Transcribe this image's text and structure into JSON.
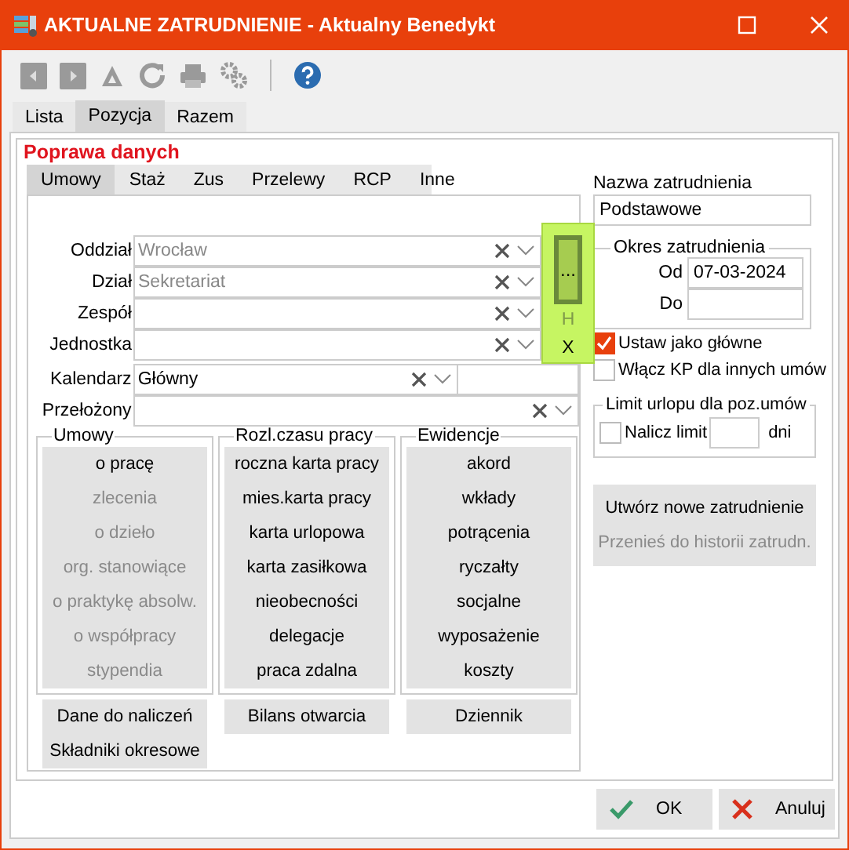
{
  "window": {
    "title": "AKTUALNE ZATRUDNIENIE - Aktualny Benedykt"
  },
  "tabs": [
    {
      "label": "Lista",
      "selected": false
    },
    {
      "label": "Pozycja",
      "selected": true
    },
    {
      "label": "Razem",
      "selected": false
    }
  ],
  "panel_title": "Poprawa danych",
  "subtabs": [
    {
      "label": "Umowy",
      "selected": true
    },
    {
      "label": "Staż",
      "selected": false
    },
    {
      "label": "Zus",
      "selected": false
    },
    {
      "label": "Przelewy",
      "selected": false
    },
    {
      "label": "RCP",
      "selected": false
    },
    {
      "label": "Inne",
      "selected": false
    }
  ],
  "fields": [
    {
      "label": "Oddział",
      "value": "Wrocław",
      "dimmed": true,
      "kind": "linked"
    },
    {
      "label": "Dział",
      "value": "Sekretariat",
      "dimmed": true,
      "kind": "linked"
    },
    {
      "label": "Zespół",
      "kind": "linked"
    },
    {
      "label": "Jednostka",
      "kind": "linked"
    },
    {
      "label": "Kalendarz",
      "value": "Główny",
      "dimmed": false,
      "kind": "short"
    },
    {
      "label": "Przełożony",
      "kind": "full"
    }
  ],
  "side_buttons": [
    {
      "label": "...",
      "kind": "button"
    },
    {
      "label": "H",
      "kind": "text",
      "disabled": true
    },
    {
      "label": "X",
      "kind": "text",
      "disabled": false
    }
  ],
  "groups": [
    {
      "title": "Umowy",
      "items": [
        {
          "label": "o pracę",
          "disabled": false
        },
        {
          "label": "zlecenia",
          "disabled": true
        },
        {
          "label": "o dzieło",
          "disabled": true
        },
        {
          "label": "org. stanowiące",
          "disabled": true
        },
        {
          "label": "o praktykę absolw.",
          "disabled": true
        },
        {
          "label": "o współpracy",
          "disabled": true
        },
        {
          "label": "stypendia",
          "disabled": true
        }
      ],
      "buttons": [
        "Dane do naliczeń",
        "Składniki okresowe"
      ]
    },
    {
      "title": "Rozl.czasu pracy",
      "items": [
        {
          "label": "roczna karta pracy",
          "disabled": false
        },
        {
          "label": "mies.karta pracy",
          "disabled": false
        },
        {
          "label": "karta urlopowa",
          "disabled": false
        },
        {
          "label": "karta zasiłkowa",
          "disabled": false
        },
        {
          "label": "nieobecności",
          "disabled": false
        },
        {
          "label": "delegacje",
          "disabled": false
        },
        {
          "label": "praca zdalna",
          "disabled": false
        }
      ],
      "buttons": [
        "Bilans otwarcia"
      ]
    },
    {
      "title": "Ewidencje",
      "items": [
        {
          "label": "akord",
          "disabled": false
        },
        {
          "label": "wkłady",
          "disabled": false
        },
        {
          "label": "potrącenia",
          "disabled": false
        },
        {
          "label": "ryczałty",
          "disabled": false
        },
        {
          "label": "socjalne",
          "disabled": false
        },
        {
          "label": "wyposażenie",
          "disabled": false
        },
        {
          "label": "koszty",
          "disabled": false
        }
      ],
      "buttons": [
        "Dziennik"
      ]
    }
  ],
  "name": {
    "label": "Nazwa zatrudnienia",
    "value": "Podstawowe"
  },
  "period": {
    "title": "Okres zatrudnienia",
    "from_label": "Od",
    "from": "07-03-2024",
    "to_label": "Do"
  },
  "checks": [
    {
      "label": "Ustaw jako główne",
      "checked": true
    },
    {
      "label": "Włącz KP dla innych umów",
      "checked": false
    }
  ],
  "limit": {
    "title": "Limit urlopu dla poz.umów",
    "label": "Nalicz limit",
    "checked": false,
    "unit": "dni"
  },
  "actions": [
    {
      "label": "Utwórz nowe zatrudnienie",
      "disabled": false
    },
    {
      "label": "Przenieś do historii zatrudn.",
      "disabled": true
    }
  ],
  "footer": [
    {
      "label": "OK",
      "kind": "ok"
    },
    {
      "label": "Anuluj",
      "kind": "cancel"
    }
  ]
}
